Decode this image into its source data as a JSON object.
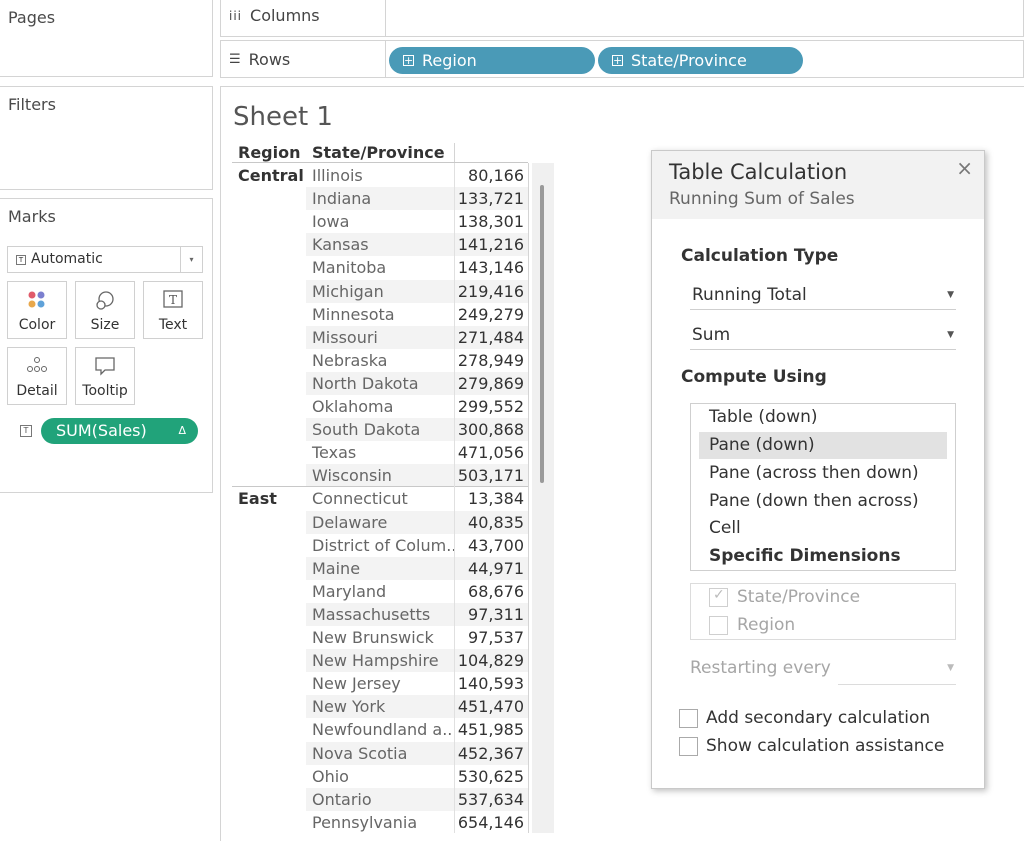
{
  "panels": {
    "pages_title": "Pages",
    "filters_title": "Filters",
    "marks_title": "Marks"
  },
  "shelves": {
    "columns_label": "Columns",
    "rows_label": "Rows",
    "rows_pills": [
      "Region",
      "State/Province"
    ]
  },
  "marks": {
    "mark_type": "Automatic",
    "buttons": [
      "Color",
      "Size",
      "Text",
      "Detail",
      "Tooltip"
    ],
    "field_pill": "SUM(Sales)",
    "field_pill_delta": "Δ"
  },
  "sheet": {
    "title": "Sheet 1",
    "headers": {
      "region": "Region",
      "state": "State/Province"
    },
    "regions": [
      {
        "name": "Central",
        "rows": [
          [
            "Illinois",
            "80,166"
          ],
          [
            "Indiana",
            "133,721"
          ],
          [
            "Iowa",
            "138,301"
          ],
          [
            "Kansas",
            "141,216"
          ],
          [
            "Manitoba",
            "143,146"
          ],
          [
            "Michigan",
            "219,416"
          ],
          [
            "Minnesota",
            "249,279"
          ],
          [
            "Missouri",
            "271,484"
          ],
          [
            "Nebraska",
            "278,949"
          ],
          [
            "North Dakota",
            "279,869"
          ],
          [
            "Oklahoma",
            "299,552"
          ],
          [
            "South Dakota",
            "300,868"
          ],
          [
            "Texas",
            "471,056"
          ],
          [
            "Wisconsin",
            "503,171"
          ]
        ]
      },
      {
        "name": "East",
        "rows": [
          [
            "Connecticut",
            "13,384"
          ],
          [
            "Delaware",
            "40,835"
          ],
          [
            "District of Colum..",
            "43,700"
          ],
          [
            "Maine",
            "44,971"
          ],
          [
            "Maryland",
            "68,676"
          ],
          [
            "Massachusetts",
            "97,311"
          ],
          [
            "New Brunswick",
            "97,537"
          ],
          [
            "New Hampshire",
            "104,829"
          ],
          [
            "New Jersey",
            "140,593"
          ],
          [
            "New York",
            "451,470"
          ],
          [
            "Newfoundland a..",
            "451,985"
          ],
          [
            "Nova Scotia",
            "452,367"
          ],
          [
            "Ohio",
            "530,625"
          ],
          [
            "Ontario",
            "537,634"
          ],
          [
            "Pennsylvania",
            "654,146"
          ]
        ]
      }
    ]
  },
  "dialog": {
    "title": "Table Calculation",
    "subtitle": "Running Sum of Sales",
    "close": "×",
    "calc_type_label": "Calculation Type",
    "calc_type_value": "Running Total",
    "agg_value": "Sum",
    "compute_using_label": "Compute Using",
    "compute_options": [
      "Table (down)",
      "Pane (down)",
      "Pane (across then down)",
      "Pane (down then across)",
      "Cell"
    ],
    "specific_dimensions_label": "Specific Dimensions",
    "dimensions": [
      {
        "label": "State/Province",
        "checked": true
      },
      {
        "label": "Region",
        "checked": false
      }
    ],
    "restarting_label": "Restarting every",
    "secondary_calc_label": "Add secondary calculation",
    "assistance_label": "Show calculation assistance"
  },
  "colors": {
    "shelf_pill": "#4a9ab7",
    "measure_pill": "#21a37a",
    "selected_option": "#e2e2e2"
  }
}
